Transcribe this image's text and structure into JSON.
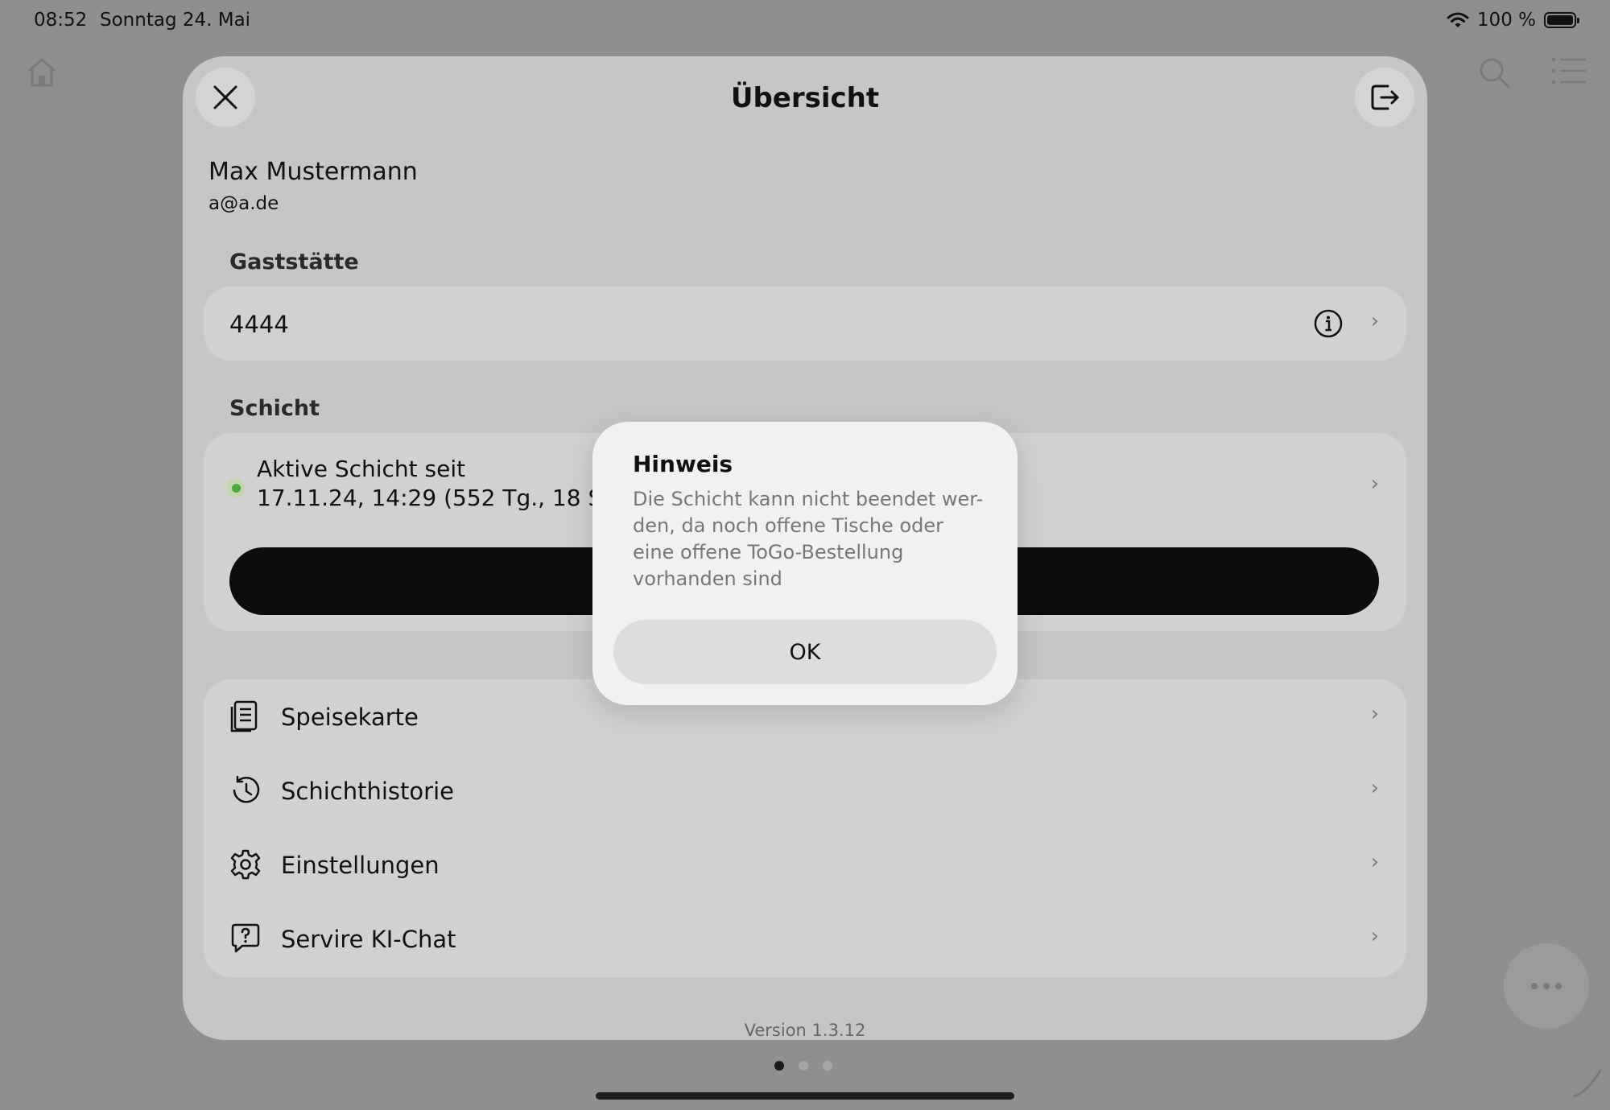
{
  "status_bar": {
    "time": "08:52",
    "date": "Sonntag 24. Mai",
    "battery": "100 %"
  },
  "sheet": {
    "title": "Übersicht",
    "close_icon": "close-icon",
    "logout_icon": "logout-icon"
  },
  "user": {
    "name": "Max Mustermann",
    "email": "a@a.de"
  },
  "restaurant": {
    "section_label": "Gaststätte",
    "value": "4444"
  },
  "shift": {
    "section_label": "Schicht",
    "status_line_1": "Aktive Schicht seit",
    "status_line_2": "17.11.24, 14:29 (552 Tg., 18 Std. und",
    "status_color": "#4caa3c"
  },
  "menu": {
    "items": [
      {
        "label": "Speisekarte",
        "icon": "menu-book-icon"
      },
      {
        "label": "Schichthistorie",
        "icon": "history-icon"
      },
      {
        "label": "Einstellungen",
        "icon": "gear-icon"
      },
      {
        "label": "Servire KI-Chat",
        "icon": "chat-question-icon"
      }
    ]
  },
  "version": "Version 1.3.12",
  "alert": {
    "title": "Hinweis",
    "message": "Die Schicht kann nicht beendet wer-den, da noch offene Tische oder eine offene ToGo-Bestellung vorhanden sind",
    "ok_label": "OK"
  }
}
